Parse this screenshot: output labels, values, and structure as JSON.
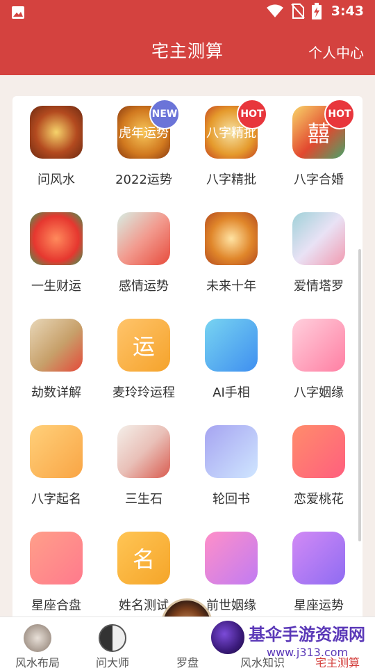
{
  "status_bar": {
    "time": "3:43",
    "icons": [
      "image-icon",
      "wifi-icon",
      "no-sim-icon",
      "battery-charging-icon"
    ]
  },
  "app_bar": {
    "title": "宅主测算",
    "right_action": "个人中心"
  },
  "grid": {
    "items": [
      {
        "label": "问风水",
        "badge": "",
        "icon": "feng-shui-compass-icon"
      },
      {
        "label": "2022运势",
        "badge": "NEW",
        "icon": "tiger-year-fortune-icon",
        "art_text": "虎年运势"
      },
      {
        "label": "八字精批",
        "badge": "HOT",
        "icon": "yin-yang-icon",
        "art_text": "八字精批"
      },
      {
        "label": "八字合婚",
        "badge": "HOT",
        "icon": "double-happiness-icon",
        "art_text": "囍"
      },
      {
        "label": "一生财运",
        "badge": "",
        "icon": "money-bag-icon"
      },
      {
        "label": "感情运势",
        "badge": "",
        "icon": "love-letter-icon"
      },
      {
        "label": "未来十年",
        "badge": "",
        "icon": "treasure-bowl-icon"
      },
      {
        "label": "爱情塔罗",
        "badge": "",
        "icon": "tarot-card-icon"
      },
      {
        "label": "劫数详解",
        "badge": "",
        "icon": "ancient-book-icon"
      },
      {
        "label": "麦玲玲运程",
        "badge": "",
        "icon": "fortune-char-icon",
        "art_text": "运"
      },
      {
        "label": "AI手相",
        "badge": "",
        "icon": "palm-scan-icon"
      },
      {
        "label": "八字姻缘",
        "badge": "",
        "icon": "hearts-icon"
      },
      {
        "label": "八字起名",
        "badge": "",
        "icon": "baby-icon"
      },
      {
        "label": "三生石",
        "badge": "",
        "icon": "crystal-stone-icon"
      },
      {
        "label": "轮回书",
        "badge": "",
        "icon": "open-book-icon"
      },
      {
        "label": "恋爱桃花",
        "badge": "",
        "icon": "peach-blossom-icon"
      },
      {
        "label": "星座合盘",
        "badge": "",
        "icon": "heart-balloons-icon"
      },
      {
        "label": "姓名测试",
        "badge": "",
        "icon": "name-card-icon",
        "art_text": "名"
      },
      {
        "label": "前世姻缘",
        "badge": "",
        "icon": "couple-silhouette-icon"
      },
      {
        "label": "星座运势",
        "badge": "",
        "icon": "star-mandala-icon"
      }
    ]
  },
  "tab_bar": {
    "tabs": [
      {
        "label": "风水布局",
        "icon": "feng-shui-icon",
        "active": false
      },
      {
        "label": "问大师",
        "icon": "yin-yang-icon",
        "active": false
      },
      {
        "label": "罗盘",
        "icon": "compass-icon",
        "active": false
      },
      {
        "label": "风水知识",
        "icon": "knowledge-icon",
        "active": false
      },
      {
        "label": "宅主测算",
        "icon": "calc-icon",
        "active": true
      }
    ]
  },
  "watermark": {
    "line1": "基伞手游资源网",
    "line2": "www.j313.com"
  },
  "colors": {
    "primary": "#d4423f",
    "background": "#f5eeea",
    "card": "#ffffff",
    "text": "#333333",
    "hot_badge": "#e8363c",
    "new_badge": "#6b74d8"
  }
}
